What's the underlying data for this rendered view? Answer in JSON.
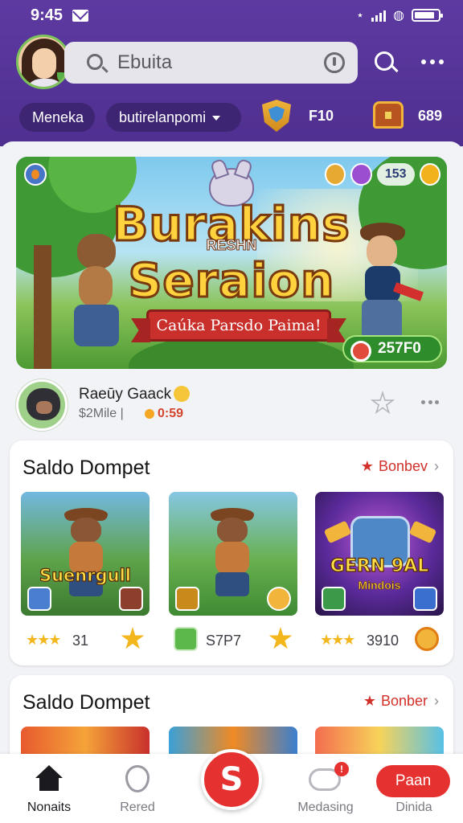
{
  "status_bar": {
    "time": "9:45",
    "battery_icon": "battery-icon",
    "wifi_icon": "wifi-icon",
    "signal_icon": "signal-icon",
    "bluetooth_icon": "bluetooth-icon",
    "signal_text": "»ııl⁰⁄₀"
  },
  "header": {
    "search_placeholder": "Ebuita",
    "chips": [
      "Meneka",
      "butirelanpomi"
    ],
    "stat_1": "F10",
    "stat_2": "689"
  },
  "hero": {
    "title_1": "Burakins",
    "subtitle": "RESHN",
    "title_2": "Seraion",
    "ribbon": "Caúka Parsdo Paima!",
    "top_badge": "153",
    "score": "257F0"
  },
  "creator": {
    "name": "Raeūy Gaack",
    "meta": "$2Mile |",
    "meta_2": "0:59"
  },
  "sections": [
    {
      "title": "Saldo Dompet",
      "link": "Bonbev",
      "tiles": [
        {
          "label": "Suenrgull",
          "value": "31"
        },
        {
          "label": "",
          "value": "S7P7"
        },
        {
          "label": "GERN 9AL",
          "sub": "Mindois",
          "value": "3910"
        }
      ]
    },
    {
      "title": "Saldo Dompet",
      "link": "Bonber"
    }
  ],
  "bottom_nav": {
    "home": "Nonaits",
    "explore": "Rered",
    "center": "S",
    "messages": "Medasing",
    "messages_badge": "!",
    "pill": "Paan",
    "last": "Dinida"
  },
  "colors": {
    "header_purple": "#5d3aa1",
    "accent_red": "#e53230",
    "star_gold": "#f3b71d"
  }
}
